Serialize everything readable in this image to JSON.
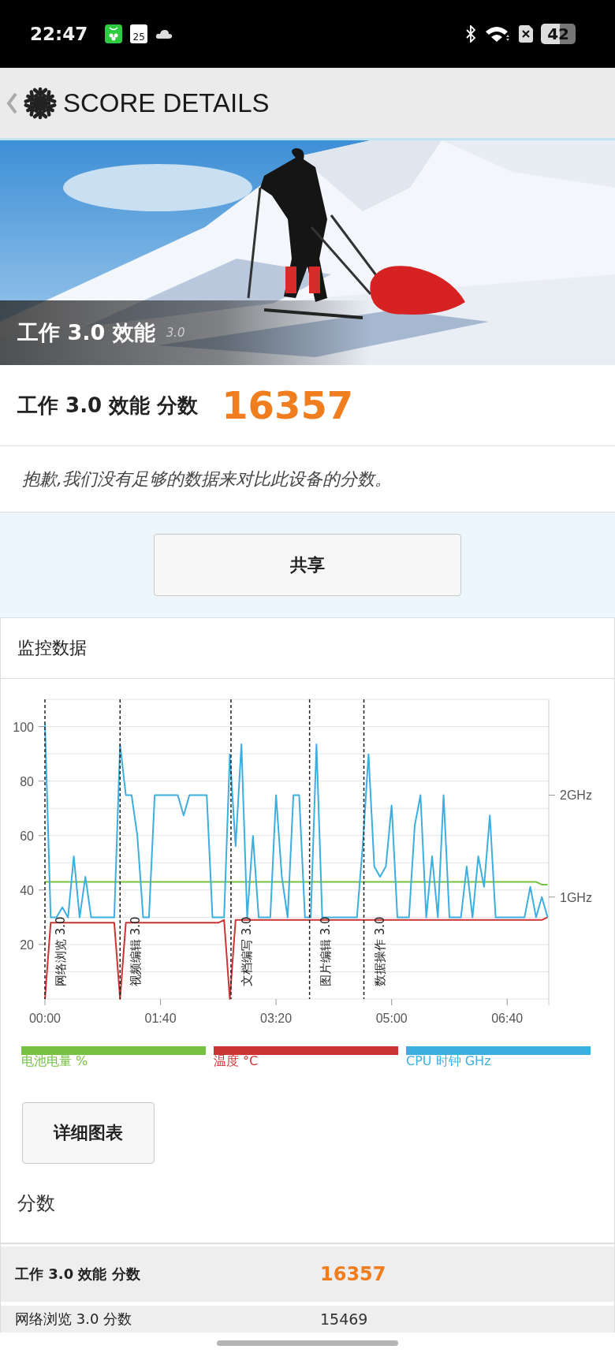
{
  "status_bar": {
    "time": "22:47",
    "calendar_day": "25",
    "battery": "42"
  },
  "header": {
    "title": "SCORE DETAILS"
  },
  "hero": {
    "kind": "picture",
    "title": "工作 3.0 效能",
    "version": "3.0"
  },
  "score": {
    "label": "工作 3.0 效能 分数",
    "value": "16357"
  },
  "notice": "抱歉,我们没有足够的数据来对比此设备的分数。",
  "share_button": "共享",
  "monitor": {
    "title": "监控数据",
    "chart_data": {
      "type": "line",
      "x": [
        0,
        5,
        10,
        15,
        20,
        25,
        30,
        35,
        40,
        45,
        50,
        55,
        60,
        65,
        70,
        75,
        80,
        85,
        90,
        95,
        100,
        105,
        110,
        115,
        120,
        125,
        130,
        135,
        140,
        145,
        150,
        155,
        160,
        165,
        170,
        175,
        180,
        185,
        190,
        195,
        200,
        205,
        210,
        215,
        220,
        225,
        230,
        235,
        240,
        245,
        250,
        255,
        260,
        265,
        270,
        275,
        280,
        285,
        290,
        295,
        300,
        305,
        310,
        315,
        320,
        325,
        330,
        335,
        340,
        345,
        350,
        355,
        360,
        365,
        370,
        375,
        380,
        385,
        390,
        395,
        400,
        405,
        410,
        415,
        420,
        425,
        430,
        435
      ],
      "xlim": [
        0,
        436
      ],
      "ylim": [
        0,
        110
      ],
      "yticks": [
        20,
        40,
        60,
        80,
        100
      ],
      "xticks": [
        {
          "value": 0,
          "label": "00:00"
        },
        {
          "value": 100,
          "label": "01:40"
        },
        {
          "value": 200,
          "label": "03:20"
        },
        {
          "value": 300,
          "label": "05:00"
        },
        {
          "value": 400,
          "label": "06:40"
        }
      ],
      "y2lim": [
        0,
        2.94
      ],
      "y2ticks": [
        {
          "value": 1,
          "label": "1GHz"
        },
        {
          "value": 2,
          "label": "2GHz"
        }
      ],
      "series": [
        {
          "name": "电池电量 %",
          "color": "#76c043",
          "values": [
            43,
            43,
            43,
            43,
            43,
            43,
            43,
            43,
            43,
            43,
            43,
            43,
            43,
            43,
            43,
            43,
            43,
            43,
            43,
            43,
            43,
            43,
            43,
            43,
            43,
            43,
            43,
            43,
            43,
            43,
            43,
            43,
            43,
            43,
            43,
            43,
            43,
            43,
            43,
            43,
            43,
            43,
            43,
            43,
            43,
            43,
            43,
            43,
            43,
            43,
            43,
            43,
            43,
            43,
            43,
            43,
            43,
            43,
            43,
            43,
            43,
            43,
            43,
            43,
            43,
            43,
            43,
            43,
            43,
            43,
            43,
            43,
            43,
            43,
            43,
            43,
            43,
            43,
            43,
            43,
            43,
            43,
            43,
            43,
            43,
            43,
            42,
            42
          ]
        },
        {
          "name": "温度 °C",
          "color": "#cc3333",
          "values": [
            0,
            28,
            28,
            28,
            28,
            28,
            28,
            28,
            28,
            28,
            28,
            28,
            28,
            0,
            28,
            28,
            28,
            28,
            28,
            28,
            28,
            28,
            28,
            28,
            28,
            28,
            28,
            28,
            28,
            28,
            28,
            29,
            0,
            29,
            29,
            29,
            29,
            29,
            29,
            29,
            29,
            29,
            29,
            29,
            29,
            29,
            29,
            29,
            29,
            29,
            29,
            29,
            29,
            29,
            29,
            29,
            29,
            29,
            29,
            29,
            29,
            29,
            29,
            29,
            29,
            29,
            29,
            29,
            29,
            29,
            29,
            29,
            29,
            29,
            29,
            29,
            29,
            29,
            29,
            29,
            29,
            29,
            29,
            29,
            29,
            29,
            29,
            30
          ]
        },
        {
          "name": "CPU 时钟 GHz",
          "color": "#3daee0",
          "axis": "y2",
          "values": [
            2.7,
            0.8,
            0.8,
            0.9,
            0.8,
            1.4,
            0.8,
            1.2,
            0.8,
            0.8,
            0.8,
            0.8,
            0.8,
            2.5,
            2.0,
            2.0,
            1.6,
            0.8,
            0.8,
            2.0,
            2.0,
            2.0,
            2.0,
            2.0,
            1.8,
            2.0,
            2.0,
            2.0,
            2.0,
            0.8,
            0.8,
            0.8,
            2.4,
            1.5,
            2.5,
            0.8,
            1.6,
            0.8,
            0.8,
            0.8,
            2.0,
            1.2,
            0.8,
            2.0,
            2.0,
            0.8,
            0.8,
            2.5,
            0.8,
            0.8,
            0.8,
            0.8,
            0.8,
            0.8,
            0.8,
            1.5,
            2.4,
            1.3,
            1.2,
            1.3,
            1.9,
            0.8,
            0.8,
            0.8,
            1.7,
            2.0,
            0.8,
            1.4,
            0.8,
            2.0,
            0.8,
            0.8,
            0.8,
            1.3,
            0.8,
            1.4,
            1.1,
            1.8,
            0.8,
            0.8,
            0.8,
            0.8,
            0.8,
            0.8,
            1.1,
            0.8,
            1.0,
            0.8
          ]
        }
      ],
      "grid": true,
      "ref_lines": [
        {
          "axis": "x",
          "value": 0,
          "label": "网络浏览 3.0"
        },
        {
          "axis": "x",
          "value": 65,
          "label": "视频编辑 3.0"
        },
        {
          "axis": "x",
          "value": 161,
          "label": "文档编写 3.0"
        },
        {
          "axis": "x",
          "value": 229,
          "label": "图片编辑 3.0"
        },
        {
          "axis": "x",
          "value": 276,
          "label": "数据操作 3.0"
        }
      ]
    }
  },
  "detail_button": "详细图表",
  "scores": {
    "title": "分数",
    "rows": [
      {
        "name": "工作 3.0 效能 分数",
        "value": "16357",
        "highlight": true
      },
      {
        "name": "网络浏览 3.0 分数",
        "value": "15469",
        "highlight": false
      }
    ]
  }
}
